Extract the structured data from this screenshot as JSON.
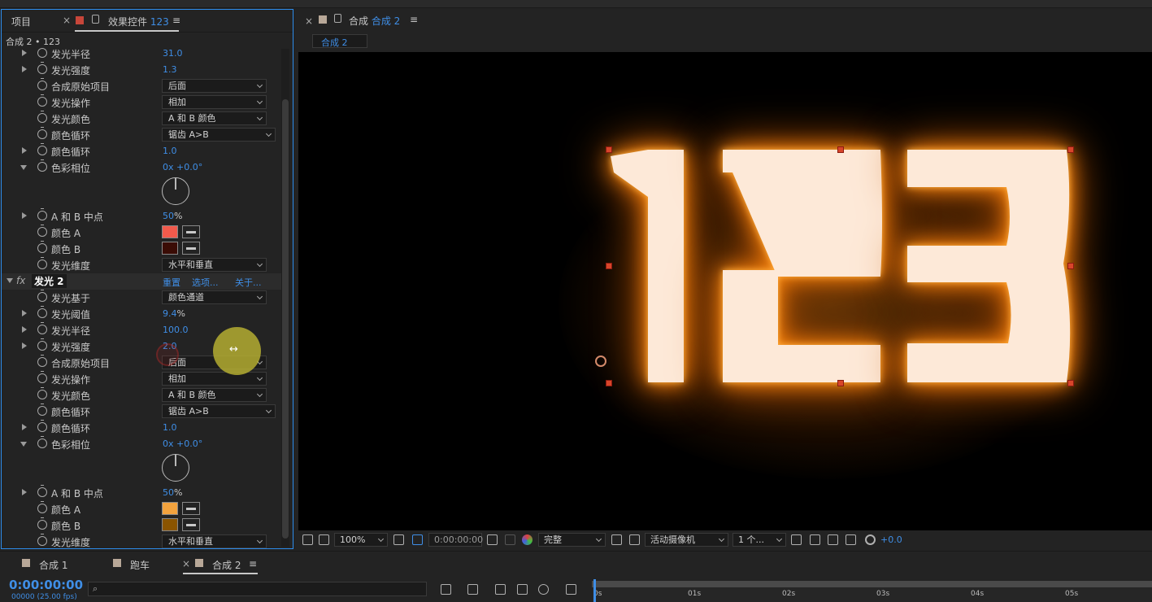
{
  "project_tab": "项目",
  "effects_tab": {
    "label": "效果控件",
    "comp": "123",
    "menu": "≡",
    "close": "×"
  },
  "breadcrumb": "合成 2 • 123",
  "params": [
    {
      "label": "发光半径",
      "value": "31.0",
      "twirl": "closed"
    },
    {
      "label": "发光强度",
      "value": "1.3",
      "twirl": "closed"
    },
    {
      "label": "合成原始项目",
      "dropdown": "后面"
    },
    {
      "label": "发光操作",
      "dropdown": "相加"
    },
    {
      "label": "发光颜色",
      "dropdown": "A 和 B 颜色"
    },
    {
      "label": "颜色循环",
      "dropdown": "锯齿 A>B",
      "wide": true
    },
    {
      "label": "颜色循环",
      "value": "1.0",
      "twirl": "closed"
    },
    {
      "label": "色彩相位",
      "value": "0x +0.0°",
      "twirl": "open"
    },
    {
      "label": "A 和 B 中点",
      "value": "50",
      "unit": "%",
      "twirl": "closed"
    },
    {
      "label": "颜色 A",
      "color": "#f25a4c"
    },
    {
      "label": "颜色 B",
      "color": "#3a0c05"
    },
    {
      "label": "发光维度",
      "dropdown": "水平和垂直"
    }
  ],
  "fx2": {
    "fx": "fx",
    "name": "发光 2",
    "reset": "重置",
    "options": "选项...",
    "about": "关于..."
  },
  "params2": [
    {
      "label": "发光基于",
      "dropdown": "颜色通道"
    },
    {
      "label": "发光阈值",
      "value": "9.4",
      "unit": "%",
      "twirl": "closed"
    },
    {
      "label": "发光半径",
      "value": "100.0",
      "twirl": "closed"
    },
    {
      "label": "发光强度",
      "value": "2.0",
      "twirl": "closed"
    },
    {
      "label": "合成原始项目",
      "dropdown": "后面"
    },
    {
      "label": "发光操作",
      "dropdown": "相加"
    },
    {
      "label": "发光颜色",
      "dropdown": "A 和 B 颜色"
    },
    {
      "label": "颜色循环",
      "dropdown": "锯齿 A>B",
      "wide": true
    },
    {
      "label": "颜色循环",
      "value": "1.0",
      "twirl": "closed"
    },
    {
      "label": "色彩相位",
      "value": "0x +0.0°",
      "twirl": "open"
    },
    {
      "label": "A 和 B 中点",
      "value": "50",
      "unit": "%",
      "twirl": "closed"
    },
    {
      "label": "颜色 A",
      "color": "#f3a33e"
    },
    {
      "label": "颜色 B",
      "color": "#8a5400"
    },
    {
      "label": "发光维度",
      "dropdown": "水平和垂直"
    }
  ],
  "comp_tab": {
    "close": "×",
    "prefix": "合成",
    "name": "合成 2",
    "menu": "≡"
  },
  "comp_subtab": "合成 2",
  "viewer_text": "123",
  "viewbar": {
    "zoom": "100%",
    "timecode": "0:00:00:00",
    "quality": "完整",
    "camera": "活动摄像机",
    "views": "1 个...",
    "exposure": "+0.0"
  },
  "timeline_tabs": [
    {
      "label": "合成 1"
    },
    {
      "label": "跑车"
    },
    {
      "label": "合成 2",
      "active": true,
      "close": "×",
      "menu": "≡"
    }
  ],
  "timeline": {
    "timecode": "0:00:00:00",
    "fps": "00000 (25.00 fps)",
    "search_placeholder": "",
    "ruler": [
      "0s",
      "01s",
      "02s",
      "03s",
      "04s",
      "05s"
    ]
  },
  "colors": {
    "accent": "#2d8ceb",
    "value_blue": "#3f8ee6",
    "glow": "#ff8a10",
    "digit": "#fde9d8",
    "handle": "#d8452a"
  }
}
